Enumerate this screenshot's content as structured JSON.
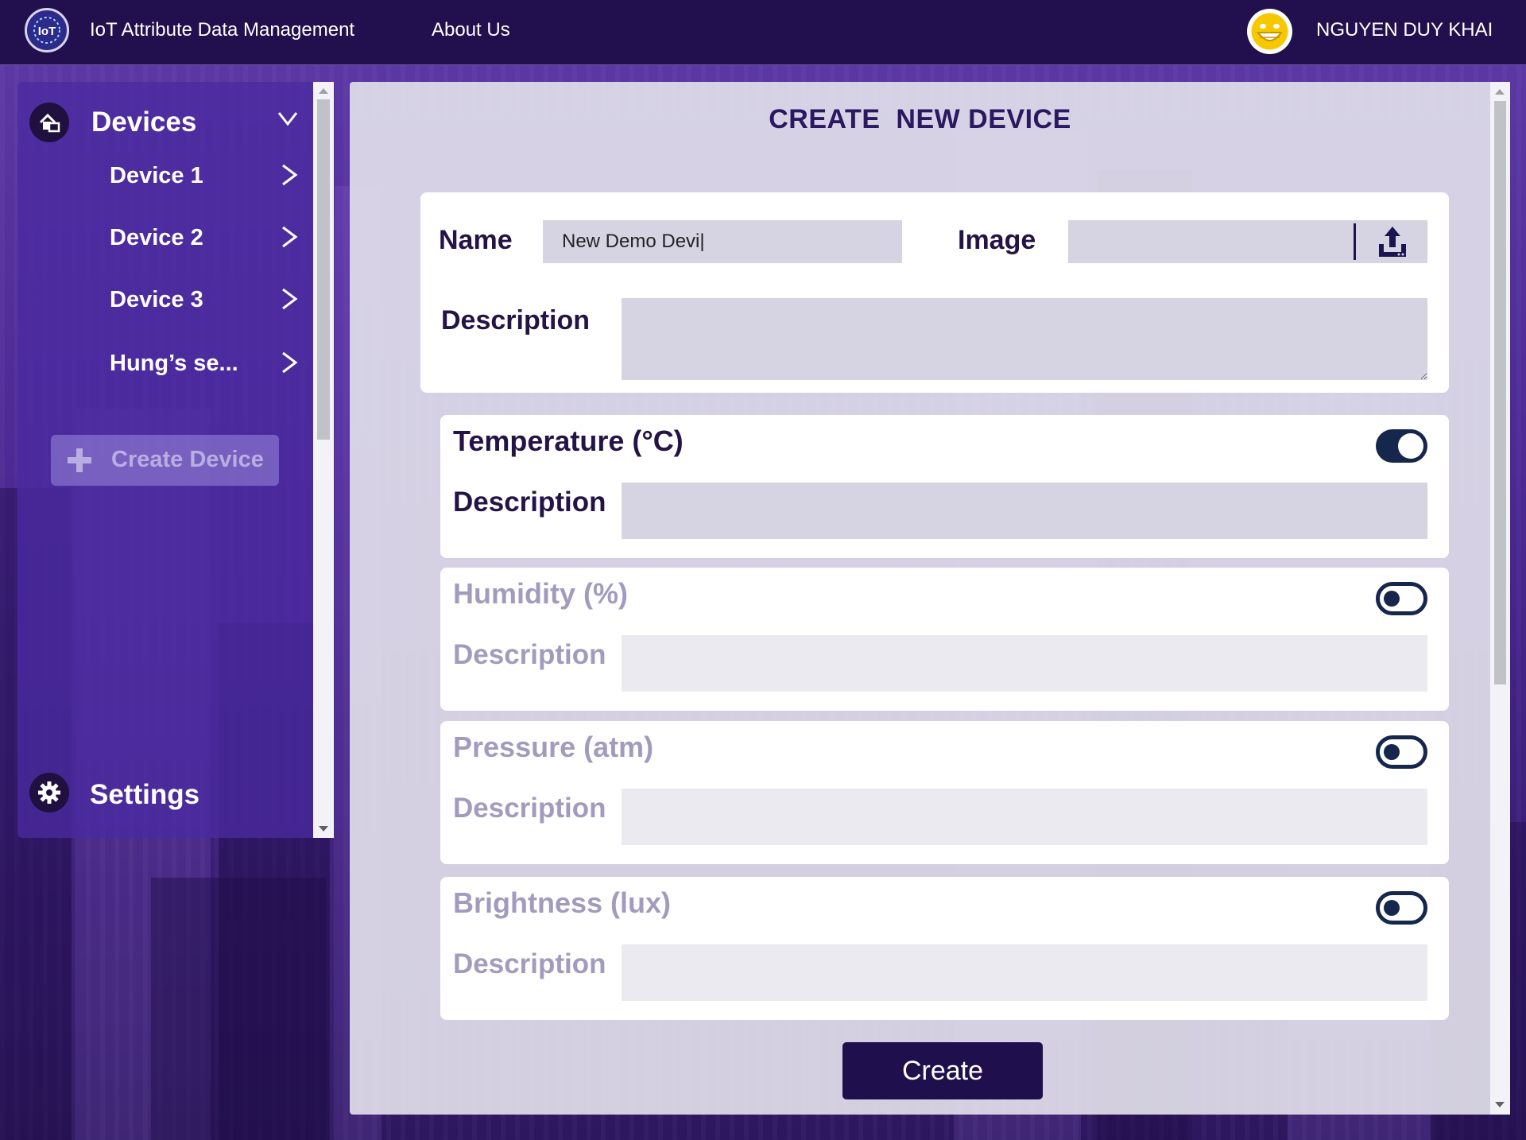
{
  "header": {
    "app_title": "IoT Attribute Data Management",
    "nav_about": "About Us",
    "user_name": "NGUYEN DUY KHAI",
    "logo_icon": "iot-logo-icon",
    "avatar_icon": "smiley-avatar-icon"
  },
  "sidebar": {
    "devices_label": "Devices",
    "devices": [
      {
        "label": "Device 1"
      },
      {
        "label": "Device 2"
      },
      {
        "label": "Device 3"
      },
      {
        "label": "Hung’s se..."
      }
    ],
    "create_device_label": "Create Device",
    "settings_label": "Settings"
  },
  "form": {
    "title": "CREATE  NEW DEVICE",
    "name_label": "Name",
    "name_value": "New Demo Devi|",
    "image_label": "Image",
    "description_label": "Description",
    "sensors": [
      {
        "title": "Temperature (°C)",
        "description_label": "Description",
        "enabled": true
      },
      {
        "title": "Humidity (%)",
        "description_label": "Description",
        "enabled": false
      },
      {
        "title": "Pressure (atm)",
        "description_label": "Description",
        "enabled": false
      },
      {
        "title": "Brightness (lux)",
        "description_label": "Description",
        "enabled": false
      }
    ],
    "submit_label": "Create"
  },
  "colors": {
    "header_bg": "#21104d",
    "sidebar_bg": "#4a2aa0",
    "label_dark": "#231347",
    "label_disabled": "#a39bbd",
    "toggle": "#16274d",
    "button_bg": "#1f0f4c"
  }
}
